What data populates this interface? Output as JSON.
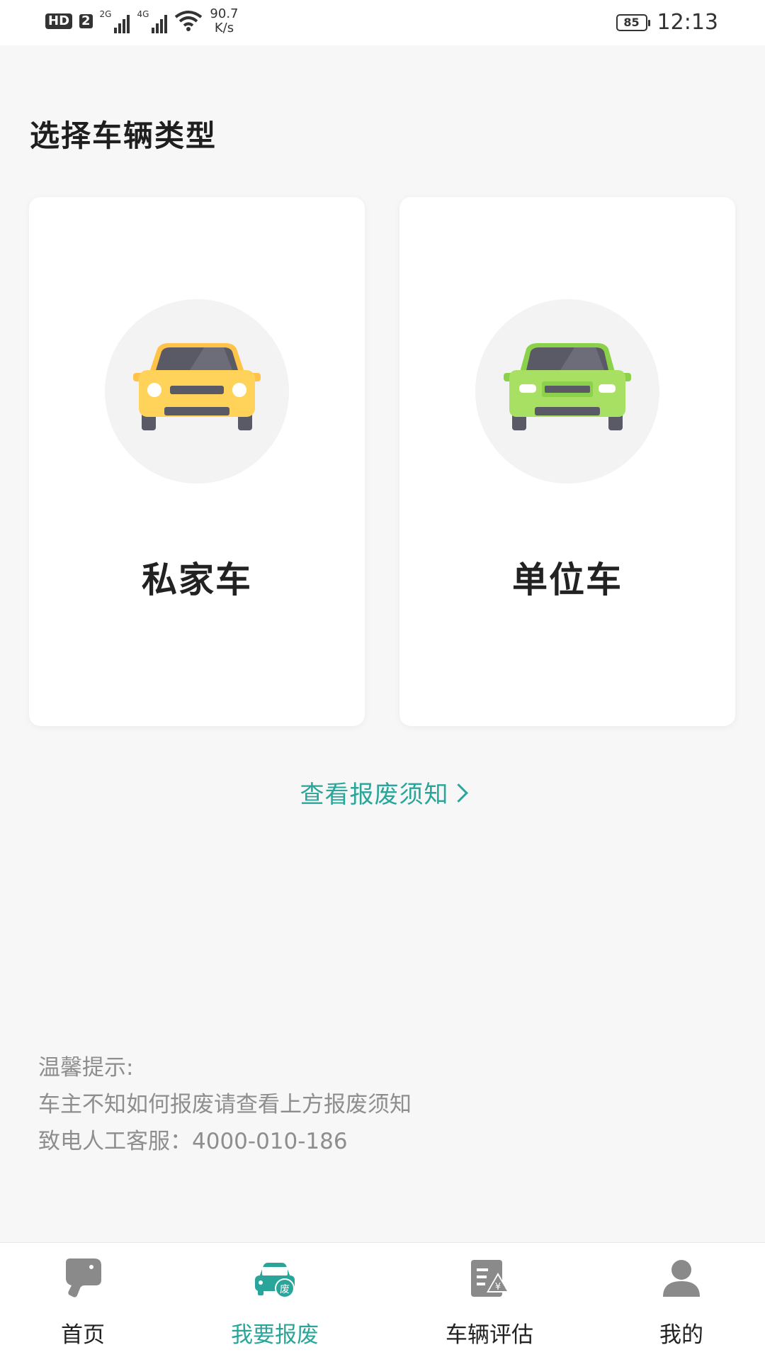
{
  "status_bar": {
    "hd": "HD",
    "sim": "2",
    "net1": "2G",
    "net2": "4G",
    "speed_value": "90.7",
    "speed_unit": "K/s",
    "battery": "85",
    "time": "12:13"
  },
  "page": {
    "title": "选择车辆类型"
  },
  "cards": [
    {
      "label": "私家车",
      "car_color": "#FFD35A"
    },
    {
      "label": "单位车",
      "car_color": "#A8E063"
    }
  ],
  "notice_link": {
    "label": "查看报废须知"
  },
  "tips": {
    "heading": "温馨提示:",
    "line1": "车主不知如何报废请查看上方报废须知",
    "line2": "致电人工客服：4000-010-186"
  },
  "bottom_nav": {
    "items": [
      {
        "label": "首页",
        "icon": "elephant-icon",
        "active": false
      },
      {
        "label": "我要报废",
        "icon": "scrap-car-icon",
        "active": true,
        "badge": "废"
      },
      {
        "label": "车辆评估",
        "icon": "evaluation-doc-icon",
        "active": false,
        "badge": "¥"
      },
      {
        "label": "我的",
        "icon": "user-icon",
        "active": false
      }
    ]
  },
  "colors": {
    "accent": "#2AA59A",
    "nav_icon_gray": "#8A8A8A",
    "yellow_car": "#FFD35A",
    "green_car": "#A8E063",
    "tips_text": "#8E8E8E"
  }
}
